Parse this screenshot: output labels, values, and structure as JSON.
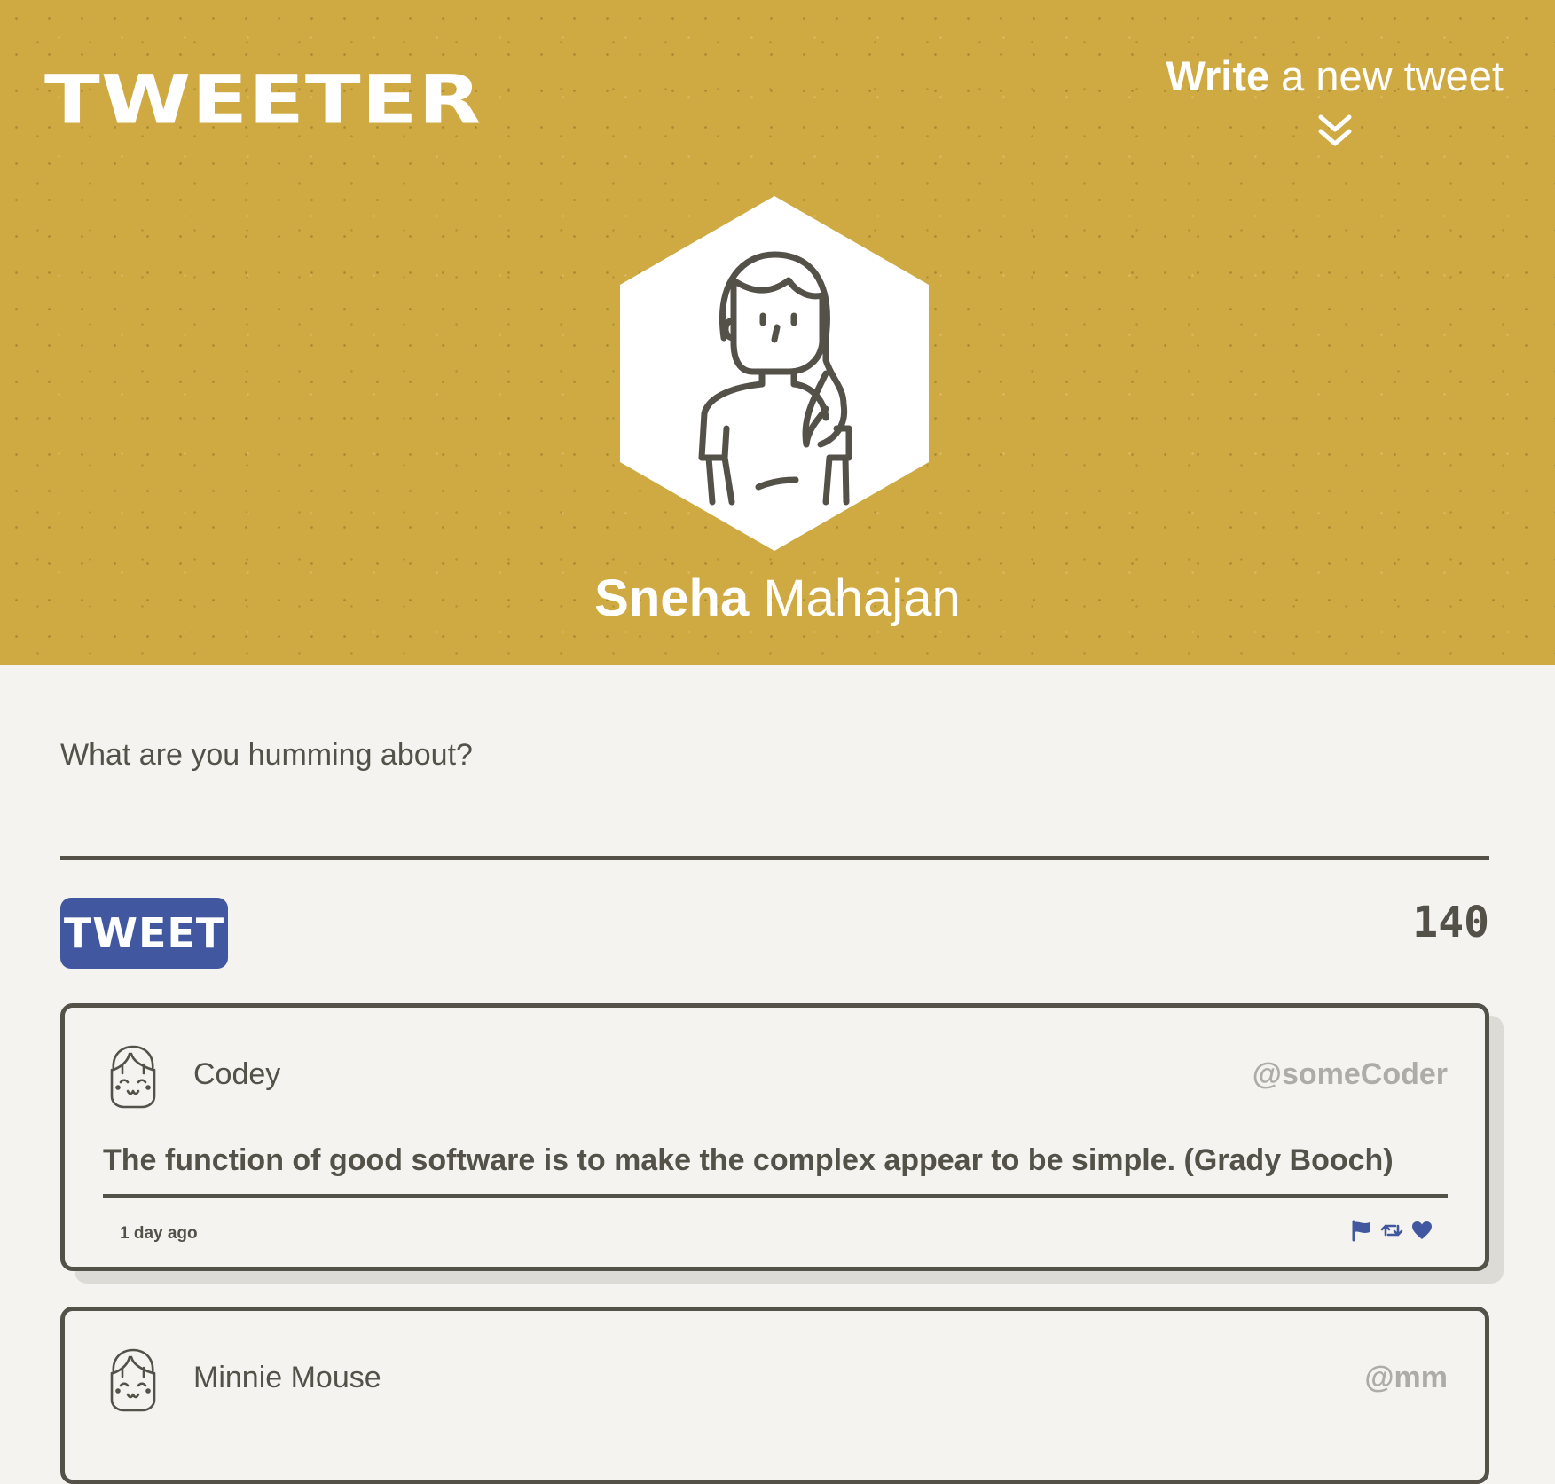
{
  "colors": {
    "header_bg": "#cfaa43",
    "page_bg": "#f4f3ef",
    "text": "#545149",
    "accent": "#4158a0",
    "handle": "#aeaca7"
  },
  "header": {
    "logo": "TWEETER",
    "write_bold": "Write",
    "write_rest": " a new tweet",
    "chevron_icon": "double-chevron-down-icon",
    "avatar_icon": "woman-avatar-icon"
  },
  "profile": {
    "first_name": "Sneha",
    "last_name": " Mahajan"
  },
  "compose": {
    "placeholder": "What are you humming about?",
    "button_label": "TWEET",
    "counter": "140"
  },
  "tweets": [
    {
      "name": "Codey",
      "handle": "@someCoder",
      "text": "The function of good software is to make the complex appear to be simple. (Grady Booch)",
      "time": "1 day ago",
      "actions": [
        "flag-icon",
        "retweet-icon",
        "heart-icon"
      ]
    },
    {
      "name": "Minnie Mouse",
      "handle": "@mm"
    }
  ]
}
